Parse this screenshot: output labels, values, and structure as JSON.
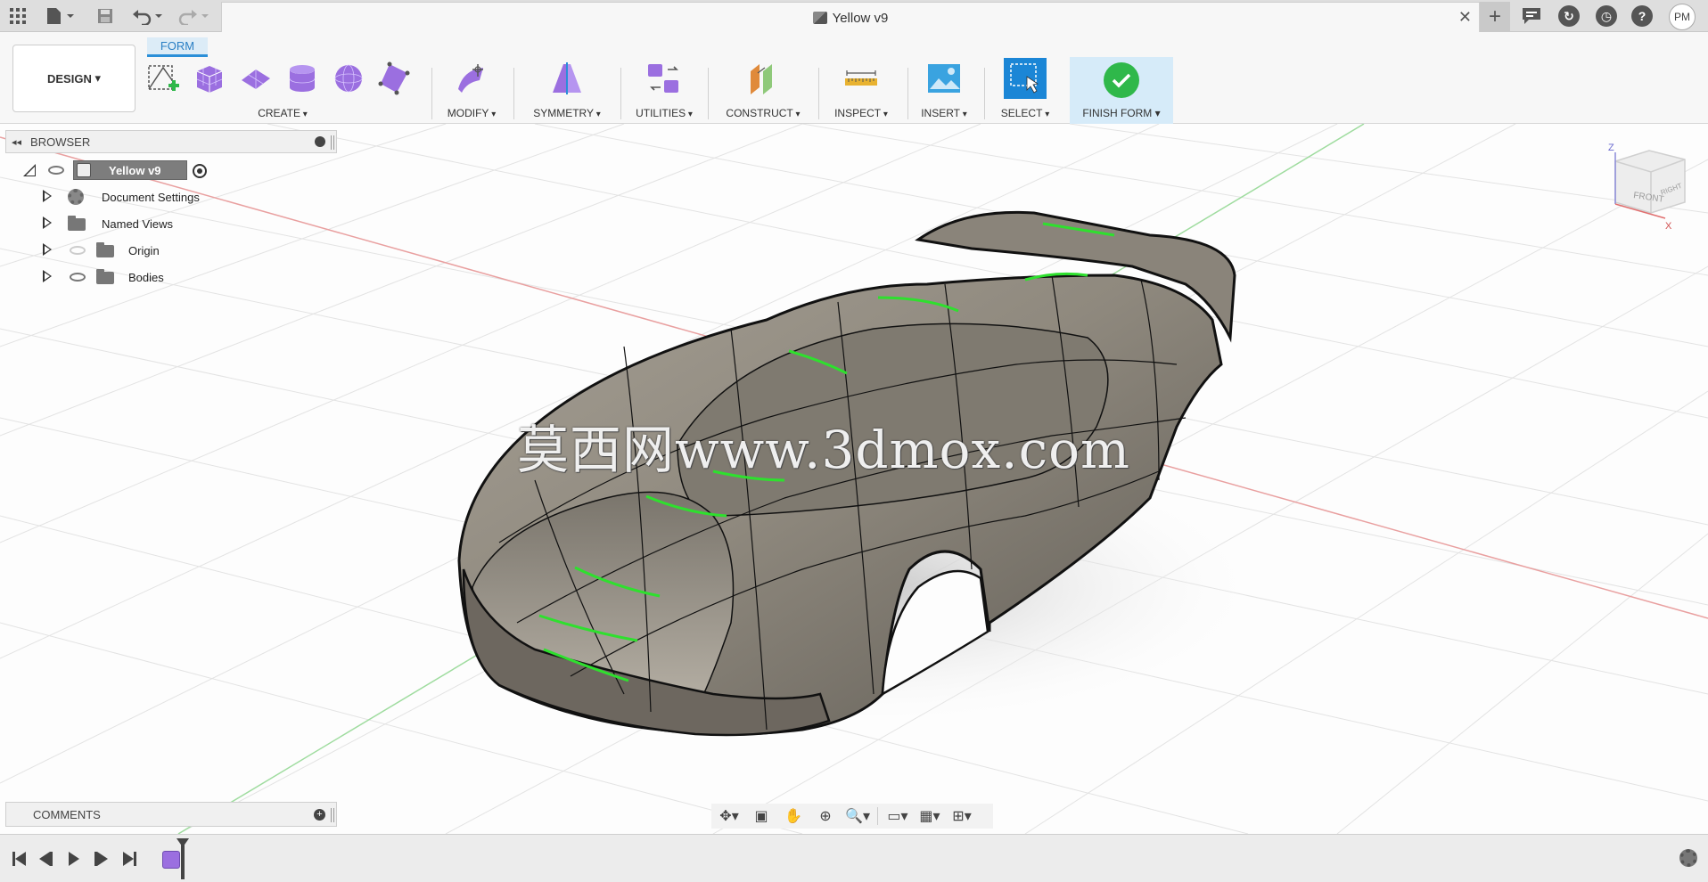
{
  "window": {
    "document_title": "Yellow v9",
    "user_initials": "PM"
  },
  "toolbar": {
    "workspace_label": "DESIGN",
    "active_tab": "FORM",
    "groups": [
      {
        "label": "CREATE"
      },
      {
        "label": "MODIFY"
      },
      {
        "label": "SYMMETRY"
      },
      {
        "label": "UTILITIES"
      },
      {
        "label": "CONSTRUCT"
      },
      {
        "label": "INSPECT"
      },
      {
        "label": "INSERT"
      },
      {
        "label": "SELECT"
      },
      {
        "label": "FINISH FORM"
      }
    ]
  },
  "browser": {
    "title": "BROWSER",
    "root": "Yellow v9",
    "items": [
      {
        "label": "Document Settings",
        "icon": "gear-icon"
      },
      {
        "label": "Named Views",
        "icon": "folder-icon"
      },
      {
        "label": "Origin",
        "icon": "folder-icon"
      },
      {
        "label": "Bodies",
        "icon": "folder-icon"
      }
    ]
  },
  "comments": {
    "title": "COMMENTS"
  },
  "viewcube": {
    "front_label": "FRONT",
    "right_label": "RIGHT",
    "z_axis": "Z",
    "x_axis": "X"
  },
  "watermark": "莫西网www.3dmox.com",
  "colors": {
    "accent": "#2a8fd8",
    "finish_green": "#2fb84a",
    "edge_green": "#2ee02e",
    "body_surface": "#8f897e"
  }
}
